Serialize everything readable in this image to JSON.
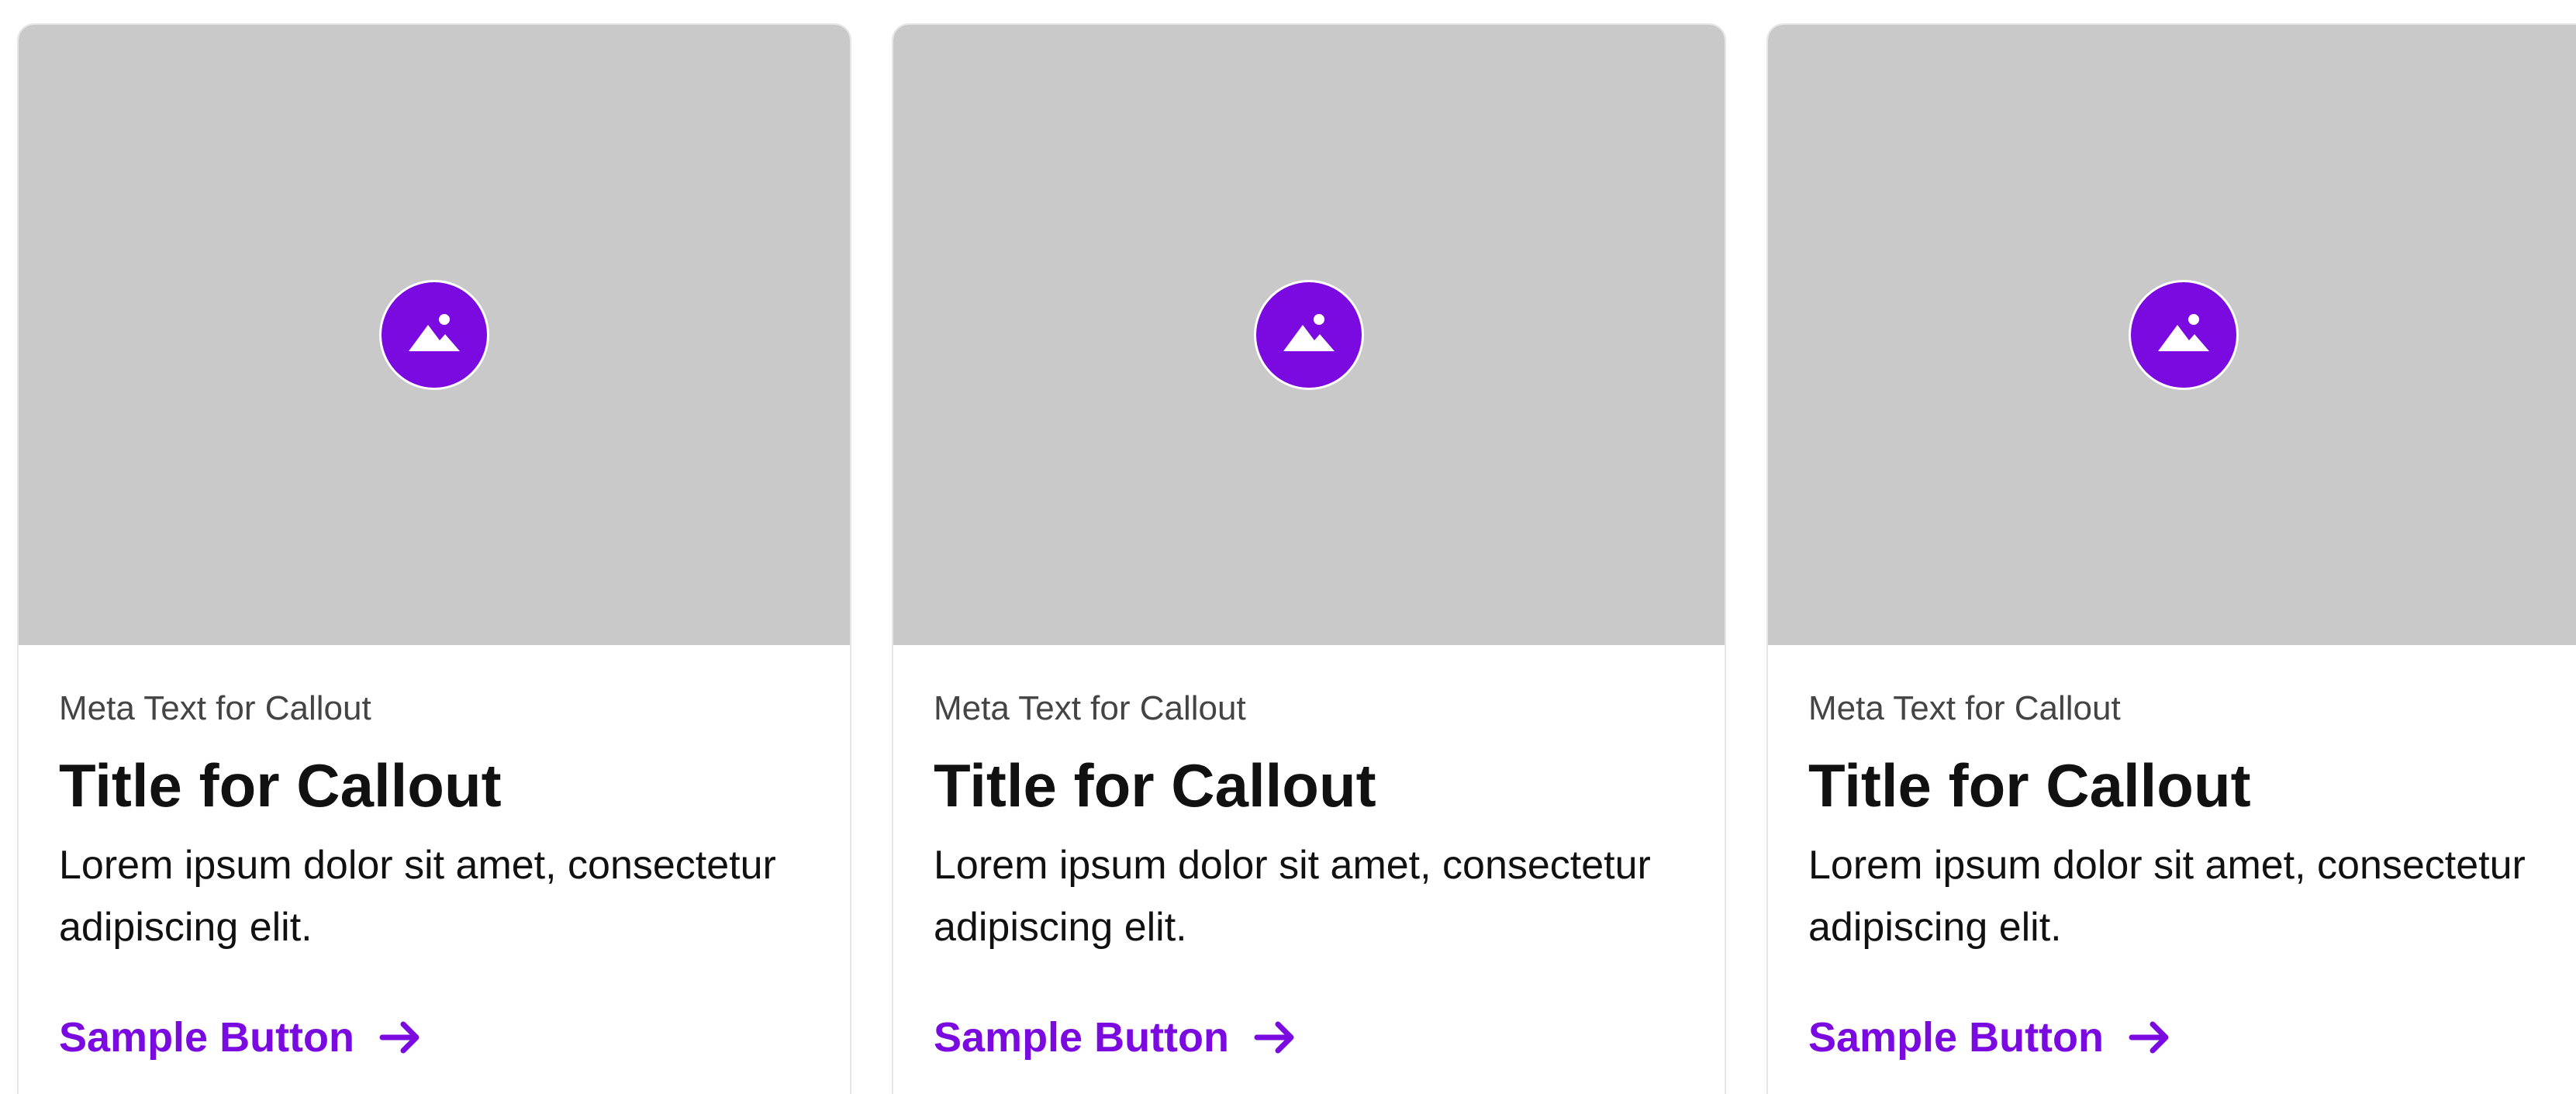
{
  "colors": {
    "accent": "#7A0AE0",
    "image_placeholder": "#C9C9C9",
    "card_border": "#E6E6E6"
  },
  "cards": [
    {
      "image_icon": "image-icon",
      "meta": "Meta Text for Callout",
      "title": "Title for Callout",
      "body": "Lorem ipsum dolor sit amet, consectetur adipiscing elit.",
      "button_label": "Sample Button",
      "button_icon": "arrow-right-icon"
    },
    {
      "image_icon": "image-icon",
      "meta": "Meta Text for Callout",
      "title": "Title for Callout",
      "body": "Lorem ipsum dolor sit amet, consectetur adipiscing elit.",
      "button_label": "Sample Button",
      "button_icon": "arrow-right-icon"
    },
    {
      "image_icon": "image-icon",
      "meta": "Meta Text for Callout",
      "title": "Title for Callout",
      "body": "Lorem ipsum dolor sit amet, consectetur adipiscing elit.",
      "button_label": "Sample Button",
      "button_icon": "arrow-right-icon"
    }
  ]
}
